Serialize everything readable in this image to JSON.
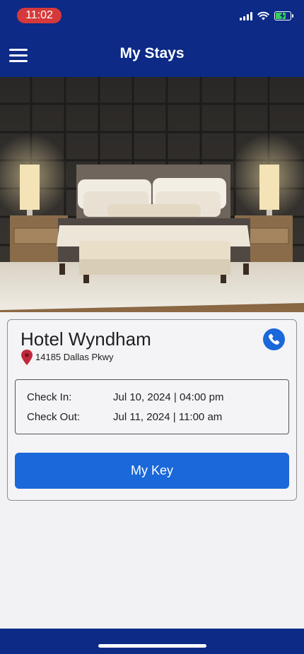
{
  "status_bar": {
    "time": "11:02",
    "signal_icon": "cellular-signal-icon",
    "wifi_icon": "wifi-icon",
    "battery_icon": "battery-charging-icon",
    "battery_level": 0.8,
    "battery_color": "#37d05a"
  },
  "header": {
    "title": "My Stays",
    "menu_icon": "hamburger-menu-icon",
    "background_color": "#0c2a86"
  },
  "hero_image": {
    "subject": "hotel bedroom"
  },
  "stay": {
    "hotel_name": "Hotel Wyndham",
    "address": "14185 Dallas Pkwy",
    "location_icon": "map-pin-icon",
    "phone_icon": "phone-icon",
    "check_in_label": "Check In:",
    "check_in_value": "Jul 10, 2024 | 04:00 pm",
    "check_out_label": "Check Out:",
    "check_out_value": "Jul 11, 2024 | 11:00 am",
    "key_button_label": "My Key",
    "accent_color": "#1a68d9"
  }
}
